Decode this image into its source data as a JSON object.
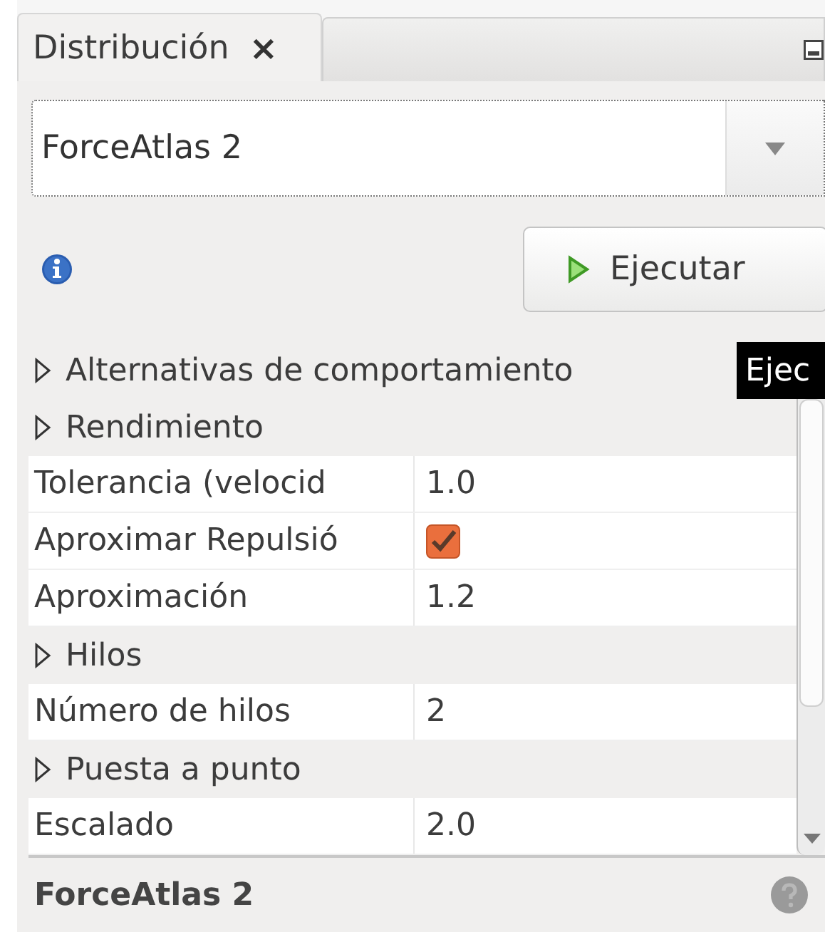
{
  "tab": {
    "label": "Distribución",
    "close": "×",
    "selected": true
  },
  "layout_select": {
    "value": "ForceAtlas 2"
  },
  "run_button": {
    "label": "Ejecutar"
  },
  "tooltip": {
    "text": "Ejec"
  },
  "properties": [
    {
      "kind": "category",
      "label": "Alternativas de comportamiento"
    },
    {
      "kind": "category",
      "label": "Rendimiento"
    },
    {
      "kind": "text",
      "name": "Tolerancia (velocid",
      "value": "1.0"
    },
    {
      "kind": "checkbox",
      "name": "Aproximar Repulsió",
      "checked": true
    },
    {
      "kind": "text",
      "name": "Aproximación",
      "value": "1.2"
    },
    {
      "kind": "category",
      "label": "Hilos"
    },
    {
      "kind": "text",
      "name": "Número de hilos",
      "value": "2"
    },
    {
      "kind": "category",
      "label": "Puesta a punto"
    },
    {
      "kind": "text",
      "name": "Escalado",
      "value": "2.0"
    }
  ],
  "footer": {
    "title": "ForceAtlas 2"
  }
}
